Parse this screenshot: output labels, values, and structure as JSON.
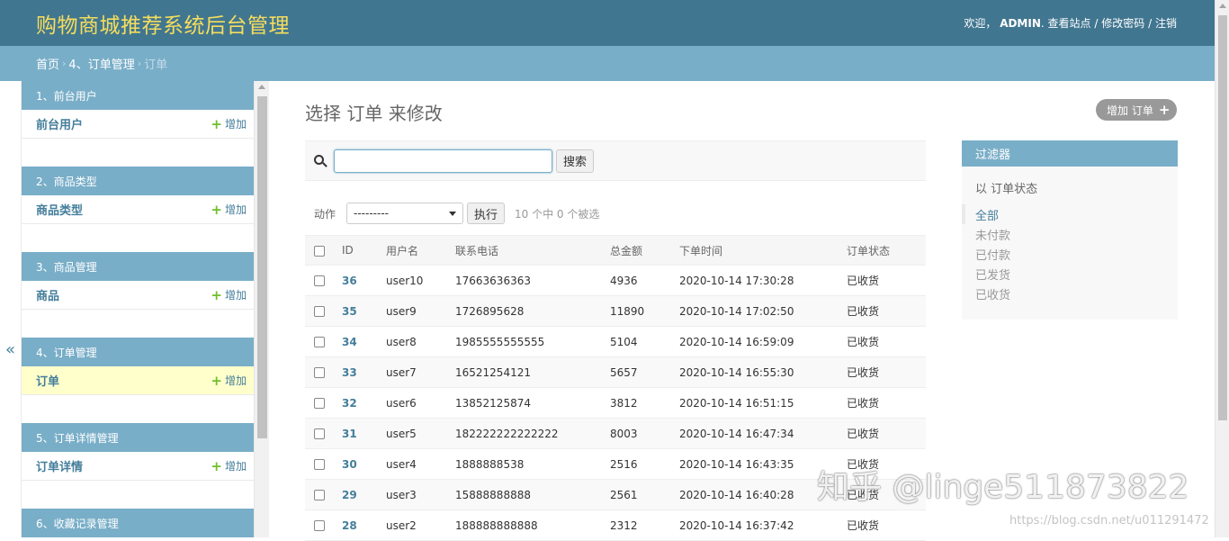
{
  "header": {
    "branding": "购物商城推荐系统后台管理",
    "welcome": "欢迎，",
    "username": "ADMIN",
    "view_site": "查看站点",
    "change_password": "修改密码",
    "logout": "注销",
    "sep": "/"
  },
  "breadcrumbs": {
    "home": "首页",
    "app": "4、订单管理",
    "current": "订单",
    "sep": "›"
  },
  "toggle_sidebar": "«",
  "sidebar": {
    "add_label": "增加",
    "modules": [
      {
        "caption": "1、前台用户",
        "model": "前台用户"
      },
      {
        "caption": "2、商品类型",
        "model": "商品类型"
      },
      {
        "caption": "3、商品管理",
        "model": "商品"
      },
      {
        "caption": "4、订单管理",
        "model": "订单"
      },
      {
        "caption": "5、订单详情管理",
        "model": "订单详情"
      },
      {
        "caption": "6、收藏记录管理",
        "model": ""
      }
    ]
  },
  "content": {
    "title": "选择 订单 来修改",
    "add_button": "增加 订单",
    "search_value": "",
    "search_button": "搜索",
    "action_label": "动作",
    "action_selected": "---------",
    "go_button": "执行",
    "counter": "10 个中 0 个被选"
  },
  "table": {
    "columns": [
      "ID",
      "用户名",
      "联系电话",
      "总金额",
      "下单时间",
      "订单状态"
    ],
    "rows": [
      {
        "id": "36",
        "user": "user10",
        "phone": "17663636363",
        "total": "4936",
        "time": "2020-10-14 17:30:28",
        "status": "已收货"
      },
      {
        "id": "35",
        "user": "user9",
        "phone": "1726895628",
        "total": "11890",
        "time": "2020-10-14 17:02:50",
        "status": "已收货"
      },
      {
        "id": "34",
        "user": "user8",
        "phone": "1985555555555",
        "total": "5104",
        "time": "2020-10-14 16:59:09",
        "status": "已收货"
      },
      {
        "id": "33",
        "user": "user7",
        "phone": "16521254121",
        "total": "5657",
        "time": "2020-10-14 16:55:30",
        "status": "已收货"
      },
      {
        "id": "32",
        "user": "user6",
        "phone": "13852125874",
        "total": "3812",
        "time": "2020-10-14 16:51:15",
        "status": "已收货"
      },
      {
        "id": "31",
        "user": "user5",
        "phone": "182222222222222",
        "total": "8003",
        "time": "2020-10-14 16:47:34",
        "status": "已收货"
      },
      {
        "id": "30",
        "user": "user4",
        "phone": "1888888538",
        "total": "2516",
        "time": "2020-10-14 16:43:35",
        "status": "已收货"
      },
      {
        "id": "29",
        "user": "user3",
        "phone": "15888888888",
        "total": "2561",
        "time": "2020-10-14 16:40:28",
        "status": "已收货"
      },
      {
        "id": "28",
        "user": "user2",
        "phone": "188888888888",
        "total": "2312",
        "time": "2020-10-14 16:37:42",
        "status": "已收货"
      }
    ]
  },
  "filter": {
    "title": "过滤器",
    "subtitle": "以 订单状态",
    "options": [
      "全部",
      "未付款",
      "已付款",
      "已发货",
      "已收货"
    ]
  },
  "watermarks": {
    "main": "知乎 @linge511873822",
    "url": "https://blog.csdn.net/u011291472"
  }
}
